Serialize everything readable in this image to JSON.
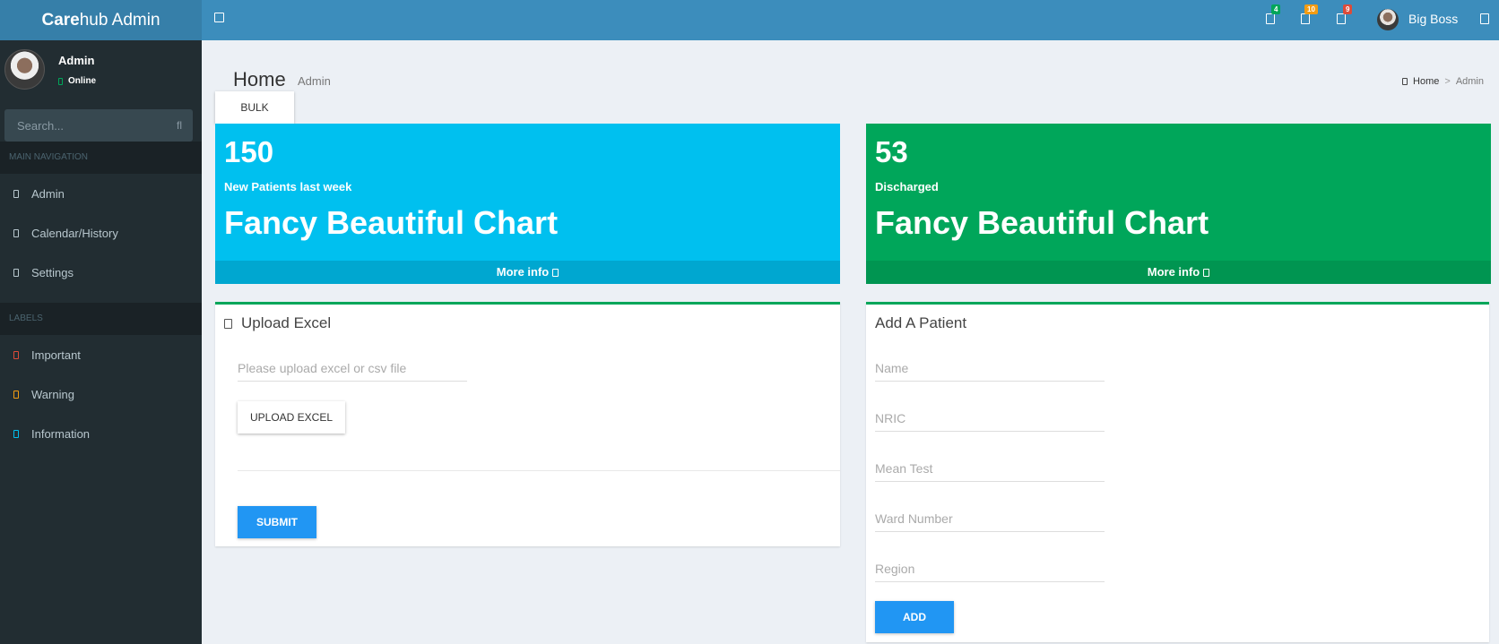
{
  "brand": {
    "bold": "Care",
    "rest": "hub Admin"
  },
  "topnav": {
    "messages_count": "4",
    "notifications_count": "10",
    "tasks_count": "9",
    "user_name": "Big Boss",
    "colors": {
      "messages": "#00a65a",
      "notifications": "#f39c12",
      "tasks": "#dd4b39"
    }
  },
  "sidebar": {
    "user_name": "Admin",
    "status": "Online",
    "search_placeholder": "Search...",
    "main_header": "MAIN NAVIGATION",
    "nav": [
      {
        "label": "Admin",
        "icon": "square-icon"
      },
      {
        "label": "Calendar/History",
        "icon": "calendar-icon"
      },
      {
        "label": "Settings",
        "icon": "gear-icon"
      }
    ],
    "labels_header": "LABELS",
    "labels": [
      {
        "label": "Important",
        "color": "#dd4b39"
      },
      {
        "label": "Warning",
        "color": "#f39c12"
      },
      {
        "label": "Information",
        "color": "#00c0ef"
      }
    ]
  },
  "content": {
    "title": "Home",
    "subtitle": "Admin",
    "breadcrumb": [
      "Home",
      "Admin"
    ],
    "bulk_tab": "BULK"
  },
  "stats": [
    {
      "number": "150",
      "label": "New Patients last week",
      "chart_text": "Fancy Beautiful Chart",
      "more": "More info",
      "color": "#00c0ef",
      "footer_color": "#00a7d0"
    },
    {
      "number": "53",
      "label": "Discharged",
      "chart_text": "Fancy Beautiful Chart",
      "more": "More info",
      "color": "#00a65a",
      "footer_color": "#009551"
    }
  ],
  "upload": {
    "title": "Upload Excel",
    "placeholder": "Please upload excel or csv file",
    "upload_btn": "UPLOAD EXCEL",
    "submit_btn": "SUBMIT"
  },
  "patient": {
    "title": "Add A Patient",
    "fields": [
      "Name",
      "NRIC",
      "Mean Test",
      "Ward Number",
      "Region"
    ],
    "add_btn": "ADD"
  }
}
